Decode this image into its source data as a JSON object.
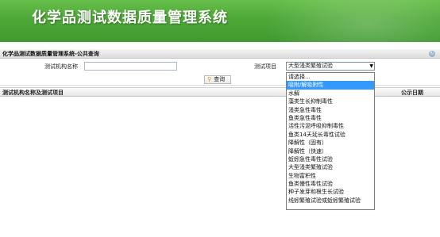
{
  "banner": {
    "title": "化学品测试数据质量管理系统"
  },
  "panel": {
    "title": "化学品测试数据质量管理系统-公共查询"
  },
  "form": {
    "agency_label": "测试机构名称",
    "agency_value": "",
    "item_label": "测试项目",
    "item_selected": "大型溞类繁殖试验"
  },
  "search": {
    "label": "查询"
  },
  "grid": {
    "col_name": "测试机构名称及测试项目",
    "col_date": "公示日期"
  },
  "dropdown": {
    "options": [
      "请选择...",
      "吸附/解吸附性",
      "水解",
      "藻类生长抑制毒性",
      "溞类急性毒性",
      "鱼类急性毒性",
      "活性污泥呼吸抑制毒性",
      "鱼类14天延长毒性试验",
      "降解性（固有）",
      "降解性（快速）",
      "蚯蚓急性毒性试验",
      "大型溞类繁殖试验",
      "生物富积性",
      "鱼类慢性毒性试验",
      "种子发芽和根生长试验",
      "线蚓繁殖试验或蚯蚓繁殖试验"
    ],
    "highlighted_index": 1
  }
}
